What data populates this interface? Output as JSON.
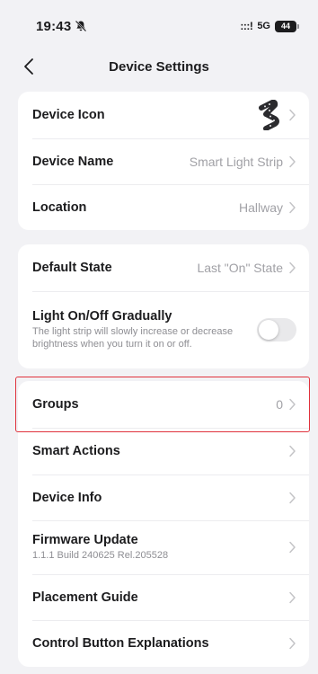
{
  "status": {
    "time": "19:43",
    "signal": ":::!",
    "network": "5G",
    "battery": "44"
  },
  "nav": {
    "title": "Device Settings"
  },
  "section1": {
    "device_icon_label": "Device Icon",
    "device_name_label": "Device Name",
    "device_name_value": "Smart Light Strip",
    "location_label": "Location",
    "location_value": "Hallway"
  },
  "section2": {
    "default_state_label": "Default State",
    "default_state_value": "Last \"On\" State",
    "gradual_label": "Light On/Off Gradually",
    "gradual_desc": "The light strip will slowly increase or decrease brightness when you turn it on or off.",
    "gradual_enabled": false
  },
  "section3": {
    "groups_label": "Groups",
    "groups_value": "0",
    "smart_actions_label": "Smart Actions",
    "device_info_label": "Device Info",
    "firmware_label": "Firmware Update",
    "firmware_version": "1.1.1 Build 240625 Rel.205528",
    "placement_label": "Placement Guide",
    "control_label": "Control Button Explanations"
  },
  "colors": {
    "highlight": "#e0323c",
    "background": "#f2f2f5"
  }
}
